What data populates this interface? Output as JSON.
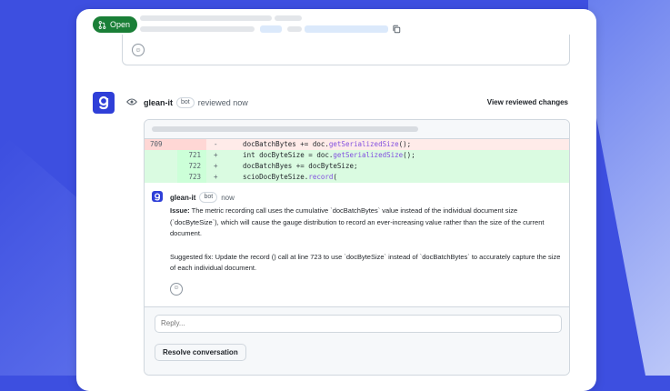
{
  "pr": {
    "status_label": "Open",
    "status_color": "#1a7f37"
  },
  "review": {
    "author": "glean-it",
    "bot_label": "bot",
    "action_text": "reviewed now",
    "view_changes_label": "View reviewed changes"
  },
  "diff": {
    "lines": [
      {
        "type": "del",
        "old": "709",
        "new": "",
        "sign": "-",
        "code": "    docBatchBytes += doc.",
        "fn": "getSerializedSize",
        "tail": "();"
      },
      {
        "type": "add",
        "old": "",
        "new": "721",
        "sign": "+",
        "code": "    int docByteSize = doc.",
        "fn": "getSerializedSize",
        "tail": "();"
      },
      {
        "type": "add",
        "old": "",
        "new": "722",
        "sign": "+",
        "code": "    docBatchByes += docByteSize;",
        "fn": "",
        "tail": ""
      },
      {
        "type": "add",
        "old": "",
        "new": "723",
        "sign": "+",
        "code": "    scioDocByteSize.",
        "fn": "record",
        "tail": "("
      }
    ]
  },
  "comment": {
    "author": "glean-it",
    "bot_label": "bot",
    "time": "now",
    "issue_label": "Issue:",
    "issue_text": " The metric recording call uses the cumulative `docBatchBytes` value instead of the individual document size (`docByteSize`), which will cause the gauge distribution to record an ever-increasing value rather than the size of the current document.",
    "suggestion_text": "Suggested fix: Update the record () call at line 723 to use `docByteSize` instead of `docBatchBytes` to accurately capture the size of each individual document."
  },
  "reply": {
    "placeholder": "Reply..."
  },
  "resolve_label": "Resolve conversation",
  "colors": {
    "background": "#3d4fe0",
    "avatar": "#2f3fd8",
    "del_bg": "#ffebe9",
    "add_bg": "#dafbe1"
  },
  "icons": [
    "git-pull-request-icon",
    "copy-icon",
    "smiley-icon",
    "eye-icon",
    "glean-logo-icon"
  ]
}
